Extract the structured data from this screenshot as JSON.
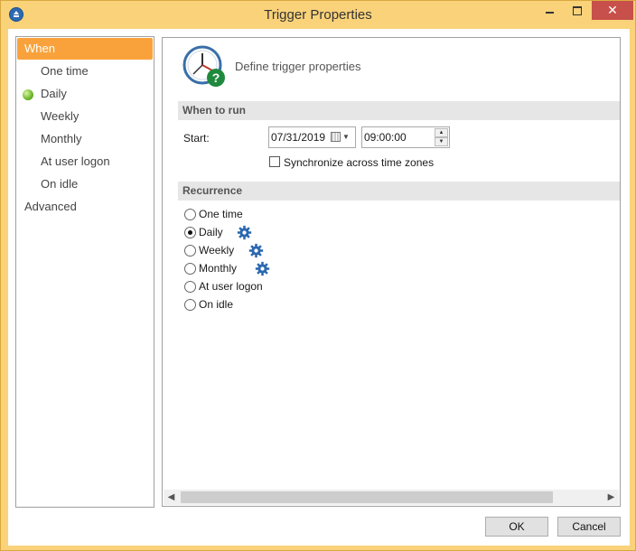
{
  "window": {
    "title": "Trigger Properties",
    "close_glyph": "✕"
  },
  "nav": {
    "items": [
      {
        "label": "When",
        "active": true
      },
      {
        "label": "One time"
      },
      {
        "label": "Daily",
        "indicator": "green-dot-icon"
      },
      {
        "label": "Weekly"
      },
      {
        "label": "Monthly"
      },
      {
        "label": "At user logon"
      },
      {
        "label": "On idle"
      },
      {
        "label": "Advanced"
      }
    ]
  },
  "header": {
    "text": "Define trigger properties",
    "icon": "clock-help-icon"
  },
  "when_to_run": {
    "section_label": "When to run",
    "start_label": "Start:",
    "date_value": "07/31/2019",
    "time_value": "09:00:00",
    "sync_label": "Synchronize across time zones",
    "sync_checked": false
  },
  "recurrence": {
    "section_label": "Recurrence",
    "options": [
      {
        "label": "One time",
        "checked": false,
        "gear": false
      },
      {
        "label": "Daily",
        "checked": true,
        "gear": true
      },
      {
        "label": "Weekly",
        "checked": false,
        "gear": true
      },
      {
        "label": "Monthly",
        "checked": false,
        "gear": true
      },
      {
        "label": "At user logon",
        "checked": false,
        "gear": false
      },
      {
        "label": "On idle",
        "checked": false,
        "gear": false
      }
    ]
  },
  "buttons": {
    "ok": "OK",
    "cancel": "Cancel"
  },
  "colors": {
    "accent": "#f9a23b",
    "frame": "#f9d27a",
    "close": "#c7504a",
    "gear": "#2c69b0"
  }
}
